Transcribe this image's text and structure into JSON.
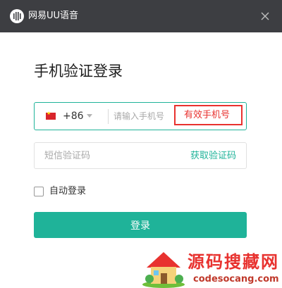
{
  "titlebar": {
    "app_title": "网易UU语音",
    "logo_icon": "uu-logo-icon",
    "close_icon": "close-icon"
  },
  "login": {
    "heading": "手机验证登录",
    "country_flag": "china-flag-icon",
    "country_code": "+86",
    "phone_placeholder": "请输入手机号",
    "phone_value": "",
    "hint": "有效手机号",
    "sms_placeholder": "短信验证码",
    "sms_value": "",
    "get_code_label": "获取验证码",
    "auto_login_label": "自动登录",
    "auto_login_checked": false,
    "login_button_label": "登录"
  },
  "watermark": {
    "title": "源码搜藏网",
    "url": "codesocang.com"
  },
  "colors": {
    "titlebar_bg": "#3d3e42",
    "accent": "#1fb399",
    "hint_red": "#e8322f"
  }
}
